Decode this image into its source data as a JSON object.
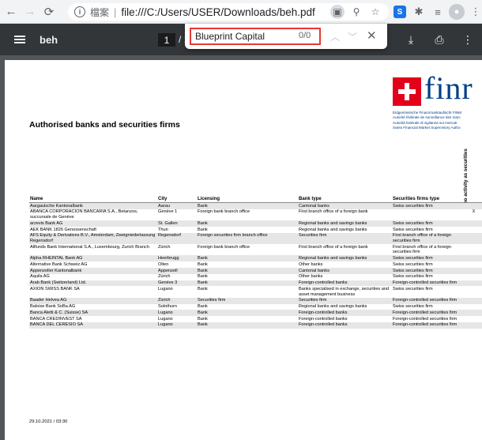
{
  "browser": {
    "scheme_label": "檔案",
    "url": "file:///C:/Users/USER/Downloads/beh.pdf"
  },
  "pdf_toolbar": {
    "title": "beh",
    "page_current": "1",
    "page_total": "/ 1"
  },
  "find": {
    "query": "Blueprint Capital",
    "count": "0/0"
  },
  "document": {
    "logo_word": "finr",
    "authority_lines": [
      "Eidgenössische Finanzmarktaufsicht FINM",
      "Autorité fédérale de surveillance des marc",
      "Autorità federale di vigilanza sui mercati",
      "Swiss Financial Market Supervisory Autho"
    ],
    "heading": "Authorised banks and securities firms",
    "vertical_label": "no activity as securities",
    "columns": [
      "Name",
      "City",
      "Licensing",
      "Bank type",
      "Securities firms type",
      ""
    ],
    "rows": [
      {
        "name": "Aargauische Kantonalbank",
        "city": "Aarau",
        "licensing": "Bank",
        "bank_type": "Cantonal banks",
        "sec_type": "Swiss securities firm",
        "flag": ""
      },
      {
        "name": "ABANCA CORPORACION BANCARIA S.A., Betanzos, succursale de Genève",
        "city": "Genève 1",
        "licensing": "Foreign bank branch office",
        "bank_type": "First branch office of a foreign bank",
        "sec_type": "",
        "flag": "X"
      },
      {
        "name": "acrevis Bank AG",
        "city": "St. Gallen",
        "licensing": "Bank",
        "bank_type": "Regional banks and savings banks",
        "sec_type": "Swiss securities firm",
        "flag": ""
      },
      {
        "name": "AEK BANK 1826 Genossenschaft",
        "city": "Thun",
        "licensing": "Bank",
        "bank_type": "Regional banks and savings banks",
        "sec_type": "Swiss securities firm",
        "flag": ""
      },
      {
        "name": "AFS Equity & Derivatives B.V., Amsterdam, Zweigniederlassung Regensdorf",
        "city": "Regensdorf",
        "licensing": "Foreign securities firm branch office",
        "bank_type": "Securities firm",
        "sec_type": "First branch office of a foreign securities firm",
        "flag": ""
      },
      {
        "name": "Allfunds Bank International S.A., Luxembourg, Zurich Branch",
        "city": "Zürich",
        "licensing": "Foreign bank branch office",
        "bank_type": "First branch office of a foreign bank",
        "sec_type": "First branch office of a foreign securities firm",
        "flag": ""
      },
      {
        "name": "Alpha RHEINTAL Bank AG",
        "city": "Heerbrugg",
        "licensing": "Bank",
        "bank_type": "Regional banks and savings banks",
        "sec_type": "Swiss securities firm",
        "flag": ""
      },
      {
        "name": "Alternative Bank Schweiz AG",
        "city": "Olten",
        "licensing": "Bank",
        "bank_type": "Other banks",
        "sec_type": "Swiss securities firm",
        "flag": ""
      },
      {
        "name": "Appenzeller Kantonalbank",
        "city": "Appenzell",
        "licensing": "Bank",
        "bank_type": "Cantonal banks",
        "sec_type": "Swiss securities firm",
        "flag": ""
      },
      {
        "name": "Aquila AG",
        "city": "Zürich",
        "licensing": "Bank",
        "bank_type": "Other banks",
        "sec_type": "Swiss securities firm",
        "flag": ""
      },
      {
        "name": "Arab Bank (Switzerland) Ltd.",
        "city": "Genève 3",
        "licensing": "Bank",
        "bank_type": "Foreign-controlled banks",
        "sec_type": "Foreign-controlled securities firm",
        "flag": ""
      },
      {
        "name": "AXION SWISS BANK SA",
        "city": "Lugano",
        "licensing": "Bank",
        "bank_type": "Banks specialised in exchange, securities and asset management business",
        "sec_type": "Swiss securities firm",
        "flag": ""
      },
      {
        "name": "Baader Helvea AG",
        "city": "Zürich",
        "licensing": "Securities firm",
        "bank_type": "Securities firm",
        "sec_type": "Foreign-controlled securities firm",
        "flag": ""
      },
      {
        "name": "Baloise Bank SoBa AG",
        "city": "Solothurn",
        "licensing": "Bank",
        "bank_type": "Regional banks and savings banks",
        "sec_type": "Swiss securities firm",
        "flag": ""
      },
      {
        "name": "Banca Aletti & C. (Suisse) SA",
        "city": "Lugano",
        "licensing": "Bank",
        "bank_type": "Foreign-controlled banks",
        "sec_type": "Foreign-controlled securities firm",
        "flag": ""
      },
      {
        "name": "BANCA CREDINVEST SA",
        "city": "Lugano",
        "licensing": "Bank",
        "bank_type": "Foreign-controlled banks",
        "sec_type": "Foreign-controlled securities firm",
        "flag": ""
      },
      {
        "name": "BANCA DEL CERESIO SA",
        "city": "Lugano",
        "licensing": "Bank",
        "bank_type": "Foreign-controlled banks",
        "sec_type": "Foreign-controlled securities firm",
        "flag": ""
      }
    ],
    "footer_date": "29.10.2021 / 03:30"
  },
  "colors": {
    "pdf_toolbar": "#323639",
    "viewer_bg": "#525659",
    "find_border": "#e53935",
    "finma_red": "#e3001b",
    "finma_blue": "#003f87"
  }
}
